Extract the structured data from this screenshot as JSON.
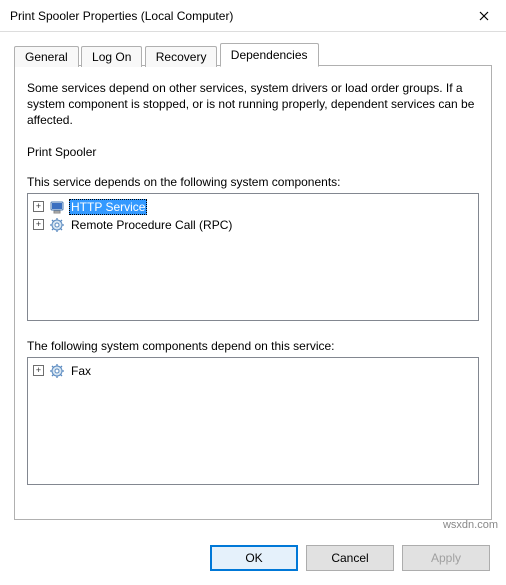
{
  "window": {
    "title": "Print Spooler Properties (Local Computer)"
  },
  "tabs": {
    "items": [
      "General",
      "Log On",
      "Recovery",
      "Dependencies"
    ],
    "activeIndex": 3
  },
  "panel": {
    "description": "Some services depend on other services, system drivers or load order groups. If a system component is stopped, or is not running properly, dependent services can be affected.",
    "serviceName": "Print Spooler",
    "dependsOnLabel": "This service depends on the following system components:",
    "dependsOn": [
      {
        "label": "HTTP Service",
        "icon": "computer",
        "selected": true,
        "expandable": true
      },
      {
        "label": "Remote Procedure Call (RPC)",
        "icon": "gear",
        "selected": false,
        "expandable": true
      }
    ],
    "dependentsLabel": "The following system components depend on this service:",
    "dependents": [
      {
        "label": "Fax",
        "icon": "gear",
        "selected": false,
        "expandable": true
      }
    ]
  },
  "buttons": {
    "ok": "OK",
    "cancel": "Cancel",
    "apply": "Apply"
  },
  "watermark": "wsxdn.com"
}
